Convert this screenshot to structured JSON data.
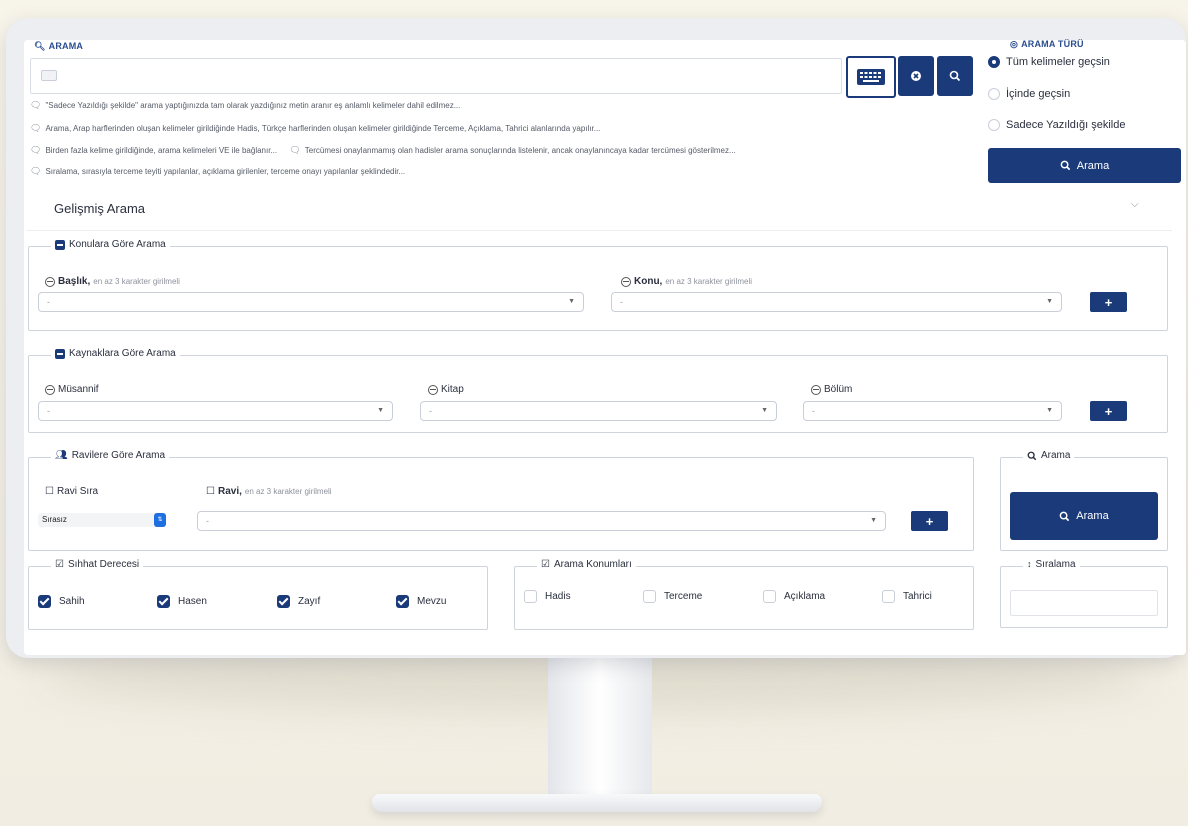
{
  "search": {
    "label": "ARAMA",
    "placeholder": ""
  },
  "hints": [
    "\"Sadece Yazıldığı şekilde\" arama yaptığınızda tam olarak yazdığınız metin aranır eş anlamlı kelimeler dahil edilmez...",
    "Arama, Arap harflerinden oluşan kelimeler girildiğinde Hadis, Türkçe harflerinden oluşan kelimeler girildiğinde Terceme, Açıklama, Tahrici alanlarında yapılır...",
    "Birden fazla kelime girildiğinde, arama kelimeleri VE ile bağlanır...",
    "Tercümesi onaylanmamış olan hadisler arama sonuçlarında listelenir, ancak onaylanıncaya kadar tercümesi gösterilmez...",
    "Sıralama, sırasıyla terceme teyiti yapılanlar, açıklama girilenler, terceme onayı yapılanlar şeklindedir..."
  ],
  "search_type": {
    "label": "ARAMA TÜRÜ",
    "options": [
      {
        "label": "Tüm kelimeler geçsin",
        "selected": true
      },
      {
        "label": "İçinde geçsin",
        "selected": false
      },
      {
        "label": "Sadece Yazıldığı şekilde",
        "selected": false
      }
    ],
    "button_label": "Arama"
  },
  "advanced": {
    "title": "Gelişmiş Arama"
  },
  "topics": {
    "legend": "Konulara Göre Arama",
    "baslik_label": "Başlık,",
    "baslik_hint": "en az 3 karakter girilmeli",
    "konu_label": "Konu,",
    "konu_hint": "en az 3 karakter girilmeli",
    "select_value": "-",
    "add_label": "+"
  },
  "sources": {
    "legend": "Kaynaklara Göre Arama",
    "musannif_label": "Müsannif",
    "kitap_label": "Kitap",
    "bolum_label": "Bölüm",
    "select_value": "-",
    "add_label": "+"
  },
  "narrators": {
    "legend": "Ravilere Göre Arama",
    "sira_label": "Ravi Sıra",
    "sira_value": "Sırasız",
    "ravi_label": "Ravi,",
    "ravi_hint": "en az 3 karakter girilmeli",
    "select_value": "-",
    "add_label": "+"
  },
  "search_box": {
    "legend": "Arama",
    "button_label": "Arama"
  },
  "authenticity": {
    "legend": "Sıhhat Derecesi",
    "items": [
      {
        "label": "Sahih",
        "checked": true
      },
      {
        "label": "Hasen",
        "checked": true
      },
      {
        "label": "Zayıf",
        "checked": true
      },
      {
        "label": "Mevzu",
        "checked": true
      }
    ]
  },
  "locations": {
    "legend": "Arama Konumları",
    "items": [
      {
        "label": "Hadis",
        "checked": false
      },
      {
        "label": "Terceme",
        "checked": false
      },
      {
        "label": "Açıklama",
        "checked": false
      },
      {
        "label": "Tahrici",
        "checked": false
      }
    ]
  },
  "sorting": {
    "legend": "Sıralama",
    "value": ""
  },
  "colors": {
    "accent": "#1b3a7a",
    "stepper": "#1e6fe0"
  }
}
